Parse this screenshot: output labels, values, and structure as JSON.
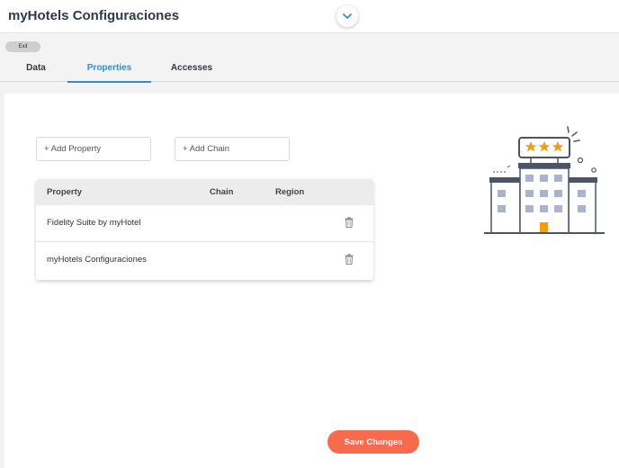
{
  "header": {
    "title": "myHotels Configuraciones"
  },
  "exit_label": "Exit",
  "tabs": [
    {
      "label": "Data",
      "active": false
    },
    {
      "label": "Properties",
      "active": true
    },
    {
      "label": "Accesses",
      "active": false
    }
  ],
  "properties": {
    "add_property_label": "+ Add Property",
    "add_chain_label": "+ Add Chain",
    "columns": [
      "Property",
      "Chain",
      "Region"
    ],
    "rows": [
      {
        "property": "Fidelity Suite by myHotel",
        "chain": "",
        "region": ""
      },
      {
        "property": "myHotels Configuraciones",
        "chain": "",
        "region": ""
      }
    ]
  },
  "save_label": "Save Changes",
  "colors": {
    "accent": "#2f8fd0",
    "save_button": "#f86a4c",
    "hotel_star": "#f39c12"
  }
}
